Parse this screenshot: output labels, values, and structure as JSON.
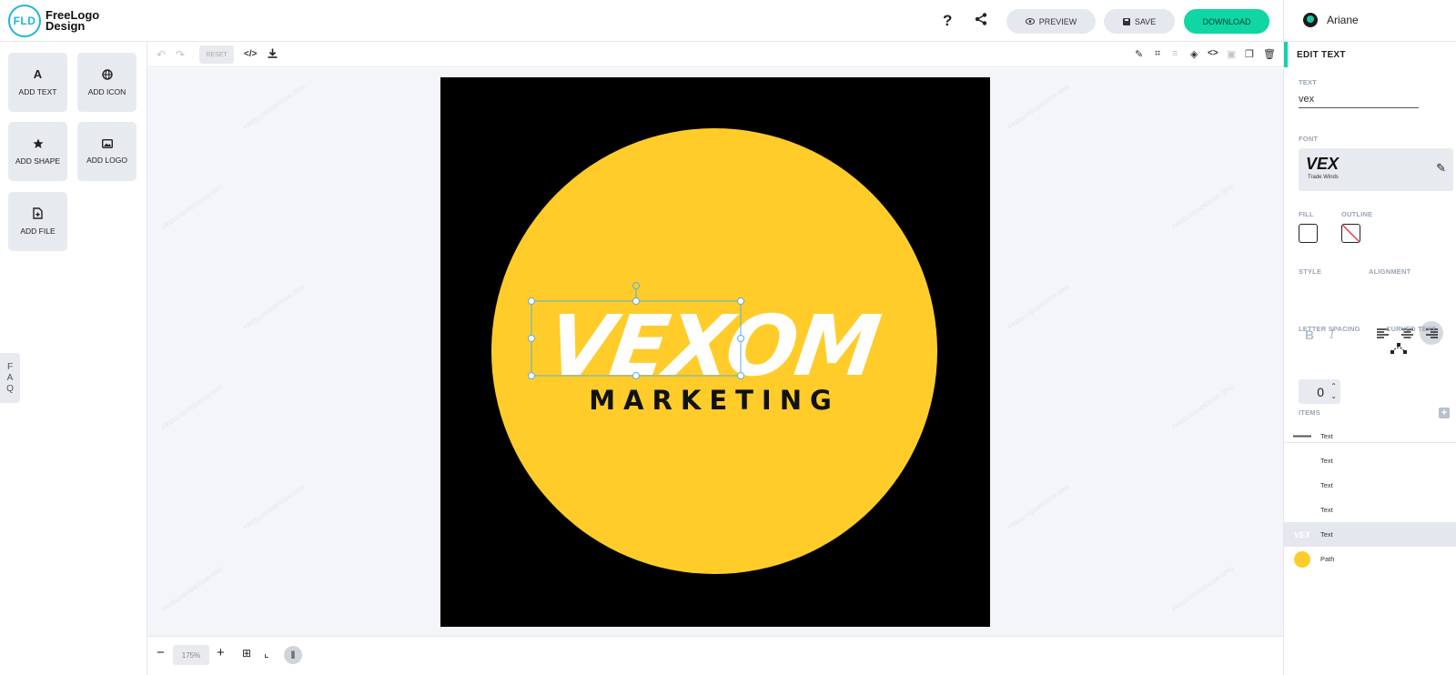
{
  "header": {
    "logo_mark": "FLD",
    "logo_line1": "FreeLogo",
    "logo_line2": "Design",
    "help_label": "?",
    "preview_label": "PREVIEW",
    "save_label": "SAVE",
    "download_label": "DOWNLOAD",
    "user_name": "Ariane"
  },
  "sidebar": {
    "tools": [
      {
        "label": "ADD TEXT",
        "icon": "text-icon"
      },
      {
        "label": "ADD ICON",
        "icon": "globe-icon"
      },
      {
        "label": "ADD SHAPE",
        "icon": "star-icon"
      },
      {
        "label": "ADD LOGO",
        "icon": "image-icon"
      },
      {
        "label": "ADD FILE",
        "icon": "file-plus-icon"
      }
    ],
    "faq_label": [
      "F",
      "A",
      "Q"
    ]
  },
  "toolbar": {
    "reset_label": "RESET"
  },
  "canvas": {
    "watermark": "FREELOGODESIGN.ORG",
    "logo_text": "VEXOM",
    "tagline": "MARKETING",
    "circle_color": "#FFCC2A",
    "background_color": "#000000"
  },
  "bottombar": {
    "zoom_label": "175%"
  },
  "edit_panel": {
    "title": "EDIT TEXT",
    "text_label": "TEXT",
    "text_value": "vex",
    "font_label": "FONT",
    "font_preview": "VEX",
    "font_name": "Trade Winds",
    "fill_label": "FILL",
    "outline_label": "OUTLINE",
    "style_label": "STYLE",
    "alignment_label": "ALIGNMENT",
    "letter_spacing_label": "LETTER SPACING",
    "letter_spacing_value": "0",
    "curved_text_label": "CURVED TEXT",
    "bold_glyph": "B",
    "italic_glyph": "I",
    "items_label": "ITEMS",
    "items": [
      {
        "label": "Text",
        "thumb": "tagline"
      },
      {
        "label": "Text",
        "thumb": ""
      },
      {
        "label": "Text",
        "thumb": ""
      },
      {
        "label": "Text",
        "thumb": ""
      },
      {
        "label": "Text",
        "thumb": "VEX",
        "selected": true
      },
      {
        "label": "Path",
        "thumb": "circle"
      }
    ]
  }
}
